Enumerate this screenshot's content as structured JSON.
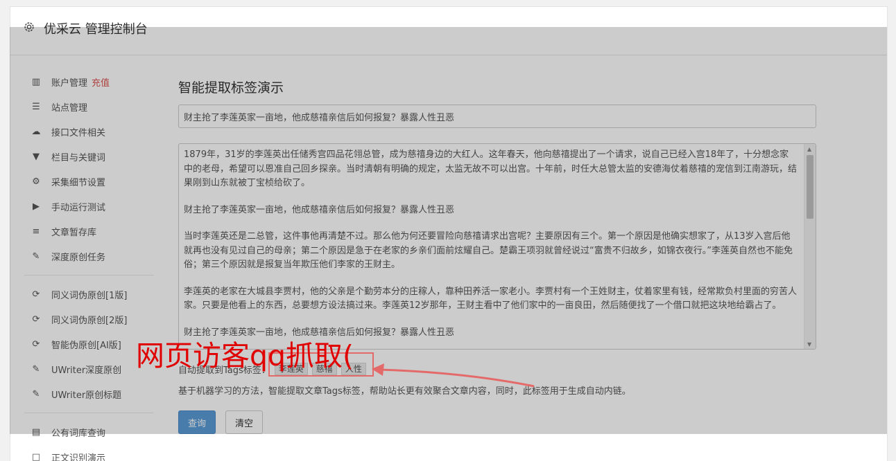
{
  "header": {
    "title": "优采云 管理控制台"
  },
  "sidebar": {
    "group1": [
      {
        "icon": "bar-chart-icon",
        "label": "账户管理",
        "badge": "充值"
      },
      {
        "icon": "list-icon",
        "label": "站点管理"
      },
      {
        "icon": "cloud-upload-icon",
        "label": "接口文件相关"
      },
      {
        "icon": "filter-icon",
        "label": "栏目与关键词"
      },
      {
        "icon": "gears-icon",
        "label": "采集细节设置"
      },
      {
        "icon": "play-circle-icon",
        "label": "手动运行测试"
      },
      {
        "icon": "database-icon",
        "label": "文章暂存库"
      },
      {
        "icon": "edit-icon",
        "label": "深度原创任务"
      }
    ],
    "group2": [
      {
        "icon": "refresh-icon",
        "label": "同义词伪原创[1版]"
      },
      {
        "icon": "refresh-icon",
        "label": "同义词伪原创[2版]"
      },
      {
        "icon": "refresh-icon",
        "label": "智能伪原创[AI版]"
      },
      {
        "icon": "edit-icon",
        "label": "UWriter深度原创"
      },
      {
        "icon": "edit-icon",
        "label": "UWriter原创标题"
      }
    ],
    "group3": [
      {
        "icon": "book-icon",
        "label": "公有词库查询"
      },
      {
        "icon": "square-icon",
        "label": "正文识别演示"
      }
    ]
  },
  "main": {
    "page_title": "智能提取标签演示",
    "title_input_value": "财主抢了李莲英家一亩地，他成慈禧亲信后如何报复？暴露人性丑恶",
    "article_paragraphs": [
      "1879年，31岁的李莲英出任储秀宫四品花翎总管，成为慈禧身边的大红人。这年春天，他向慈禧提出了一个请求，说自己已经入宫18年了，十分想念家中的老母，希望可以恩准自己回乡探亲。当时清朝有明确的规定，太监无故不可以出宫。十年前，时任大总管太监的安德海仗着慈禧的宠信到江南游玩，结果刚到山东就被丁宝桢给砍了。",
      "财主抢了李莲英家一亩地，他成慈禧亲信后如何报复？暴露人性丑恶",
      "当时李莲英还是二总管，这件事他再清楚不过。那么他为何还要冒险向慈禧请求出宫呢？主要原因有三个。第一个原因是他确实想家了，从13岁入宫后他就再也没有见过自己的母亲；第二个原因是急于在老家的乡亲们面前炫耀自己。楚霸王项羽就曾经说过“富贵不归故乡，如锦衣夜行。”李莲英自然也不能免俗；第三个原因就是报复当年欺压他们李家的王财主。",
      "李莲英的老家在大城县李贾村，他的父亲是个勤劳本分的庄稼人，靠种田养活一家老小。李贾村有一个王姓财主，仗着家里有钱，经常欺负村里面的穷苦人家。只要是他看上的东西，总要想方设法搞过来。李莲英12岁那年，王财主看中了他们家中的一亩良田，然后随便找了一个借口就把这块地给霸占了。",
      "财主抢了李莲英家一亩地，他成慈禧亲信后如何报复？暴露人性丑恶"
    ],
    "tags_label": "自动提取到Tags标签：",
    "tags": [
      "李莲英",
      "慈禧",
      "人性"
    ],
    "description": "基于机器学习的方法，智能提取文章Tags标签，帮助站长更有效聚合文章内容，同时，此标签用于生成自动内链。",
    "query_button": "查询",
    "clear_button": "清空"
  },
  "watermark": {
    "text": "网页访客qq抓取("
  },
  "colors": {
    "badge_red": "#d9534f",
    "primary_blue": "#5b9bd5",
    "watermark_red": "#e00000"
  }
}
